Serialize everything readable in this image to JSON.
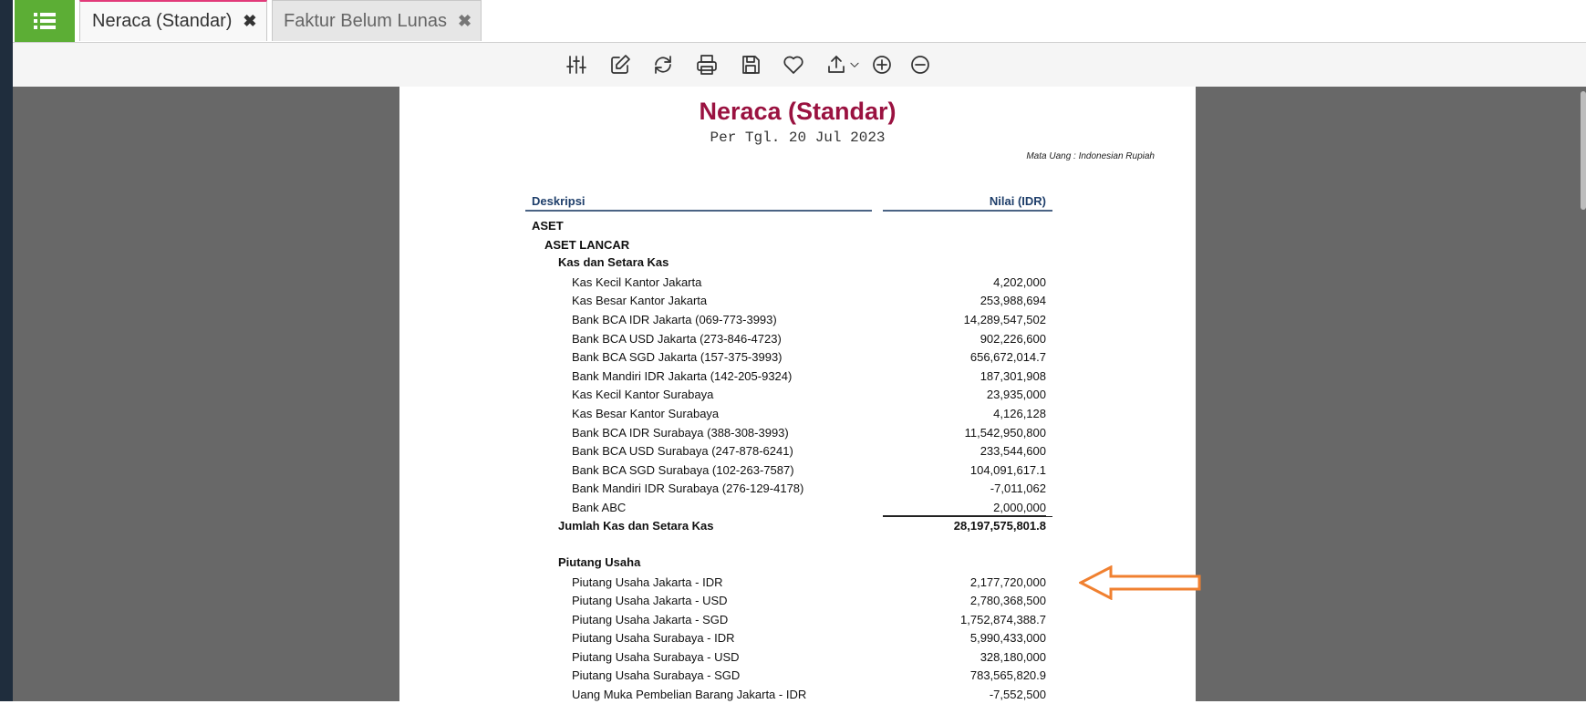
{
  "tabs": [
    {
      "label": "Neraca (Standar)",
      "close": "✖"
    },
    {
      "label": "Faktur Belum Lunas",
      "close": "✖"
    }
  ],
  "toolbar_icons": [
    "sliders-icon",
    "edit-icon",
    "refresh-icon",
    "print-icon",
    "save-icon",
    "favorite-icon",
    "export-icon",
    "zoom-in-icon",
    "zoom-out-icon"
  ],
  "report": {
    "title": "Neraca (Standar)",
    "date": "Per Tgl. 20 Jul 2023",
    "currency": "Mata Uang : Indonesian Rupiah",
    "col_desc": "Deskripsi",
    "col_value": "Nilai (IDR)",
    "rows": [
      {
        "d": "ASET",
        "v": ""
      },
      {
        "d": "ASET LANCAR",
        "v": ""
      },
      {
        "d": "Kas dan Setara Kas",
        "v": ""
      },
      {
        "d": "Kas Kecil Kantor Jakarta",
        "v": "4,202,000"
      },
      {
        "d": "Kas Besar Kantor Jakarta",
        "v": "253,988,694"
      },
      {
        "d": "Bank BCA IDR Jakarta (069-773-3993)",
        "v": "14,289,547,502"
      },
      {
        "d": "Bank BCA USD Jakarta (273-846-4723)",
        "v": "902,226,600"
      },
      {
        "d": "Bank BCA SGD Jakarta (157-375-3993)",
        "v": "656,672,014.7"
      },
      {
        "d": "Bank Mandiri IDR Jakarta (142-205-9324)",
        "v": "187,301,908"
      },
      {
        "d": "Kas Kecil Kantor Surabaya",
        "v": "23,935,000"
      },
      {
        "d": "Kas Besar Kantor Surabaya",
        "v": "4,126,128"
      },
      {
        "d": "Bank BCA IDR Surabaya (388-308-3993)",
        "v": "11,542,950,800"
      },
      {
        "d": "Bank BCA USD Surabaya (247-878-6241)",
        "v": "233,544,600"
      },
      {
        "d": "Bank BCA SGD Surabaya (102-263-7587)",
        "v": "104,091,617.1"
      },
      {
        "d": "Bank Mandiri IDR Surabaya (276-129-4178)",
        "v": "-7,011,062"
      },
      {
        "d": "Bank ABC",
        "v": "2,000,000"
      },
      {
        "d": "Jumlah Kas dan Setara Kas",
        "v": "28,197,575,801.8"
      },
      {
        "d": "Piutang Usaha",
        "v": ""
      },
      {
        "d": "Piutang Usaha Jakarta - IDR",
        "v": "2,177,720,000"
      },
      {
        "d": "Piutang Usaha Jakarta - USD",
        "v": "2,780,368,500"
      },
      {
        "d": "Piutang Usaha Jakarta - SGD",
        "v": "1,752,874,388.7"
      },
      {
        "d": "Piutang Usaha Surabaya - IDR",
        "v": "5,990,433,000"
      },
      {
        "d": "Piutang Usaha Surabaya - USD",
        "v": "328,180,000"
      },
      {
        "d": "Piutang Usaha Surabaya - SGD",
        "v": "783,565,820.9"
      },
      {
        "d": "Uang Muka Pembelian Barang Jakarta - IDR",
        "v": "-7,552,500"
      }
    ]
  },
  "annotation": {
    "icon": "arrow-left-icon",
    "color": "#f08030"
  }
}
